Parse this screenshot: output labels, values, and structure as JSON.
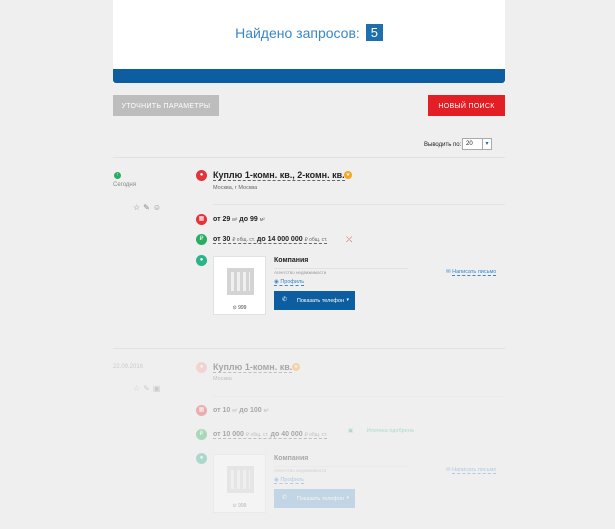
{
  "header": {
    "found_label": "Найдено запросов:",
    "found_count": "5"
  },
  "controls": {
    "refine_label": "УТОЧНИТЬ ПАРАМЕТРЫ",
    "new_search_label": "НОВЫЙ ПОИСК",
    "per_page_label": "Выводить по:",
    "per_page_value": "20"
  },
  "listings": [
    {
      "date": "Сегодня",
      "title": "Куплю 1-комн. кв., 2-комн. кв.",
      "city": "Москва, г Москва",
      "area_from": "от 29",
      "area_to": "до 99",
      "area_unit": "м²",
      "price_from": "от 30",
      "price_from_unit": "₽ общ. ст.",
      "price_to": "до 14 000 000",
      "price_to_unit": "₽ общ. ст.",
      "company_name": "Компания",
      "agency_type": "Агентство недвижимости",
      "profile_label": "Профиль",
      "phone_label": "Показать телефон",
      "company_number": "999",
      "write_label": "Написать письмо"
    },
    {
      "date": "22.09.2016",
      "title": "Куплю 1-комн. кв.",
      "city": "Москва",
      "area_from": "от 10",
      "area_to": "до 100",
      "area_unit": "м²",
      "price_from": "от 10 000",
      "price_from_unit": "₽ общ. ст.",
      "price_to": "до 40 000",
      "price_to_unit": "₽ общ. ст.",
      "extra_note": "Ипотека одобрена",
      "company_name": "Компания",
      "agency_type": "Агентство недвижимости",
      "profile_label": "Профиль",
      "phone_label": "Показать телефон",
      "company_number": "999",
      "write_label": "Написать письмо"
    }
  ],
  "colors": {
    "accent_blue": "#0c5ea1",
    "link_blue": "#3a86c8",
    "red": "#e31e24",
    "green": "#27ae60"
  }
}
